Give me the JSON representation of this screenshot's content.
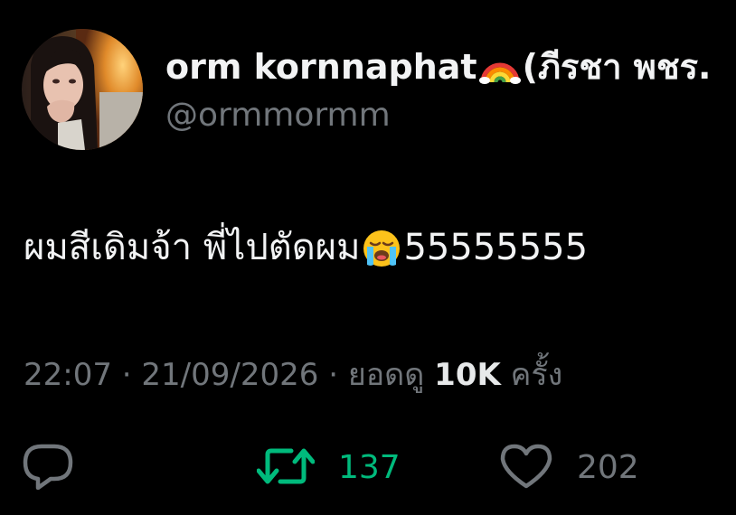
{
  "author": {
    "display_name": "orm kornnaphat",
    "display_name_suffix": "(ภีรชา พชร.",
    "handle": "@ormmormm",
    "avatar_icon": "profile-photo"
  },
  "tweet": {
    "text_before_emoji": "ผมสีเดิมจ้า พี่ไปตัดผม",
    "emoji_icon": "loudly-crying-face-emoji",
    "text_after_emoji": "55555555"
  },
  "meta": {
    "time": "22:07",
    "separator": "·",
    "date": "21/09/2026",
    "views_label": "ยอดดู",
    "views_count": "10K",
    "views_suffix": "ครั้ง"
  },
  "actions": {
    "reply": {
      "icon": "reply-icon",
      "count": ""
    },
    "retweet": {
      "icon": "retweet-icon",
      "count": "137"
    },
    "like": {
      "icon": "heart-icon",
      "count": "202"
    }
  },
  "colors": {
    "background": "#000000",
    "primary_text": "#e7e9ea",
    "secondary_text": "#71767b",
    "retweet_active": "#00ba7c"
  }
}
